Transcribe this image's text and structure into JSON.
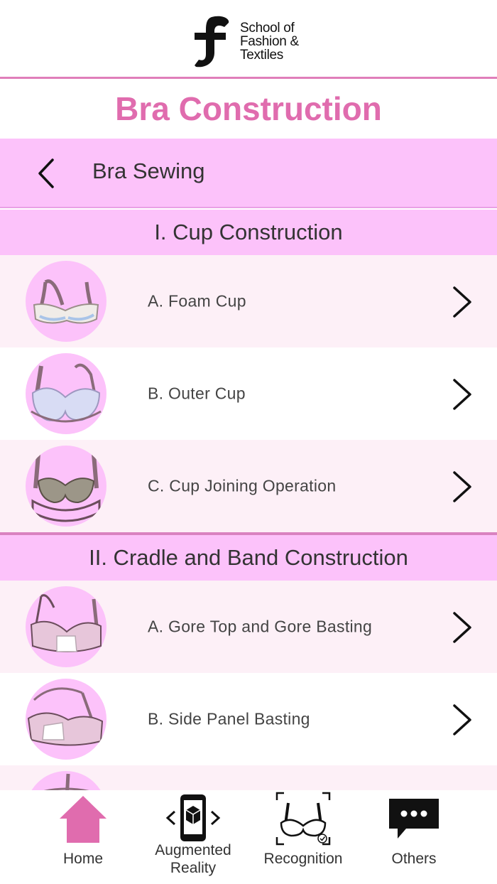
{
  "header": {
    "logo_line1": "School of",
    "logo_line2": "Fashion &",
    "logo_line3": "Textiles"
  },
  "page_title": "Bra Construction",
  "subnav": {
    "title": "Bra Sewing"
  },
  "sections": [
    {
      "title": "I. Cup Construction",
      "items": [
        {
          "label": "A. Foam Cup"
        },
        {
          "label": "B. Outer Cup"
        },
        {
          "label": "C. Cup Joining Operation"
        }
      ]
    },
    {
      "title": "II. Cradle and Band Construction",
      "items": [
        {
          "label": "A. Gore Top and Gore Basting"
        },
        {
          "label": "B. Side Panel Basting"
        }
      ]
    }
  ],
  "tabbar": {
    "home": "Home",
    "ar_line1": "Augmented",
    "ar_line2": "Reality",
    "recognition": "Recognition",
    "others": "Others"
  },
  "colors": {
    "accent": "#e06cae",
    "pink_band": "#fcc2fa",
    "row_alt": "#fdf0f7",
    "separator": "#d982c0"
  }
}
